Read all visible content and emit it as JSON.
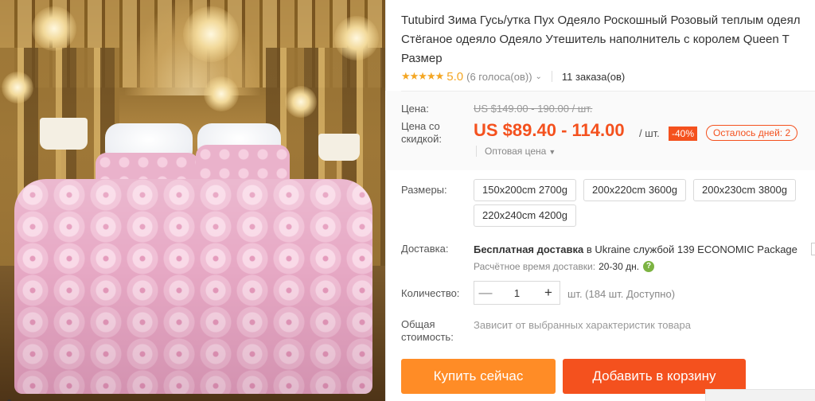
{
  "product": {
    "title_lines": [
      "Tutubird Зима Гусь/утка Пух Одеяло Роскошный Розовый теплым одеял",
      "Стёганое одеяло Одеяло Утешитель наполнитель с королем Queen T",
      "Размер"
    ],
    "image_alt_icon": "bed-photo"
  },
  "rating": {
    "stars": "★★★★★",
    "score": "5.0",
    "votes": "(6 голоса(ов))",
    "orders": "11 заказа(ов)"
  },
  "price": {
    "label": "Цена:",
    "old": "US $149.00 - 190.00 / шт.",
    "discount_label": "Цена со скидкой:",
    "new": "US $89.40 - 114.00",
    "unit": "/ шт.",
    "discount_badge": "-40%",
    "days_left": "Осталось дней: 2",
    "wholesale": "Оптовая цена"
  },
  "sizes": {
    "label": "Размеры:",
    "options": [
      "150x200cm 2700g",
      "200x220cm 3600g",
      "200x230cm 3800g",
      "220x240cm 4200g"
    ]
  },
  "shipping": {
    "label": "Доставка:",
    "prefix": "Бесплатная доставка",
    "middle": " в Ukraine службой ",
    "service": "139 ECONOMIC Package",
    "eta_label": "Расчётное время доставки:",
    "eta_value": "20-30 дн."
  },
  "quantity": {
    "label": "Количество:",
    "value": "1",
    "note": "шт. (184 шт. Доступно)"
  },
  "total": {
    "label_line1": "Общая",
    "label_line2": "стоимость:",
    "note": "Зависит от выбранных характеристик товара"
  },
  "actions": {
    "buy": "Купить сейчас",
    "cart": "Добавить в корзину"
  },
  "colors": {
    "accent": "#f4511e",
    "buy": "#ff8c26",
    "stars": "#f4a623"
  }
}
